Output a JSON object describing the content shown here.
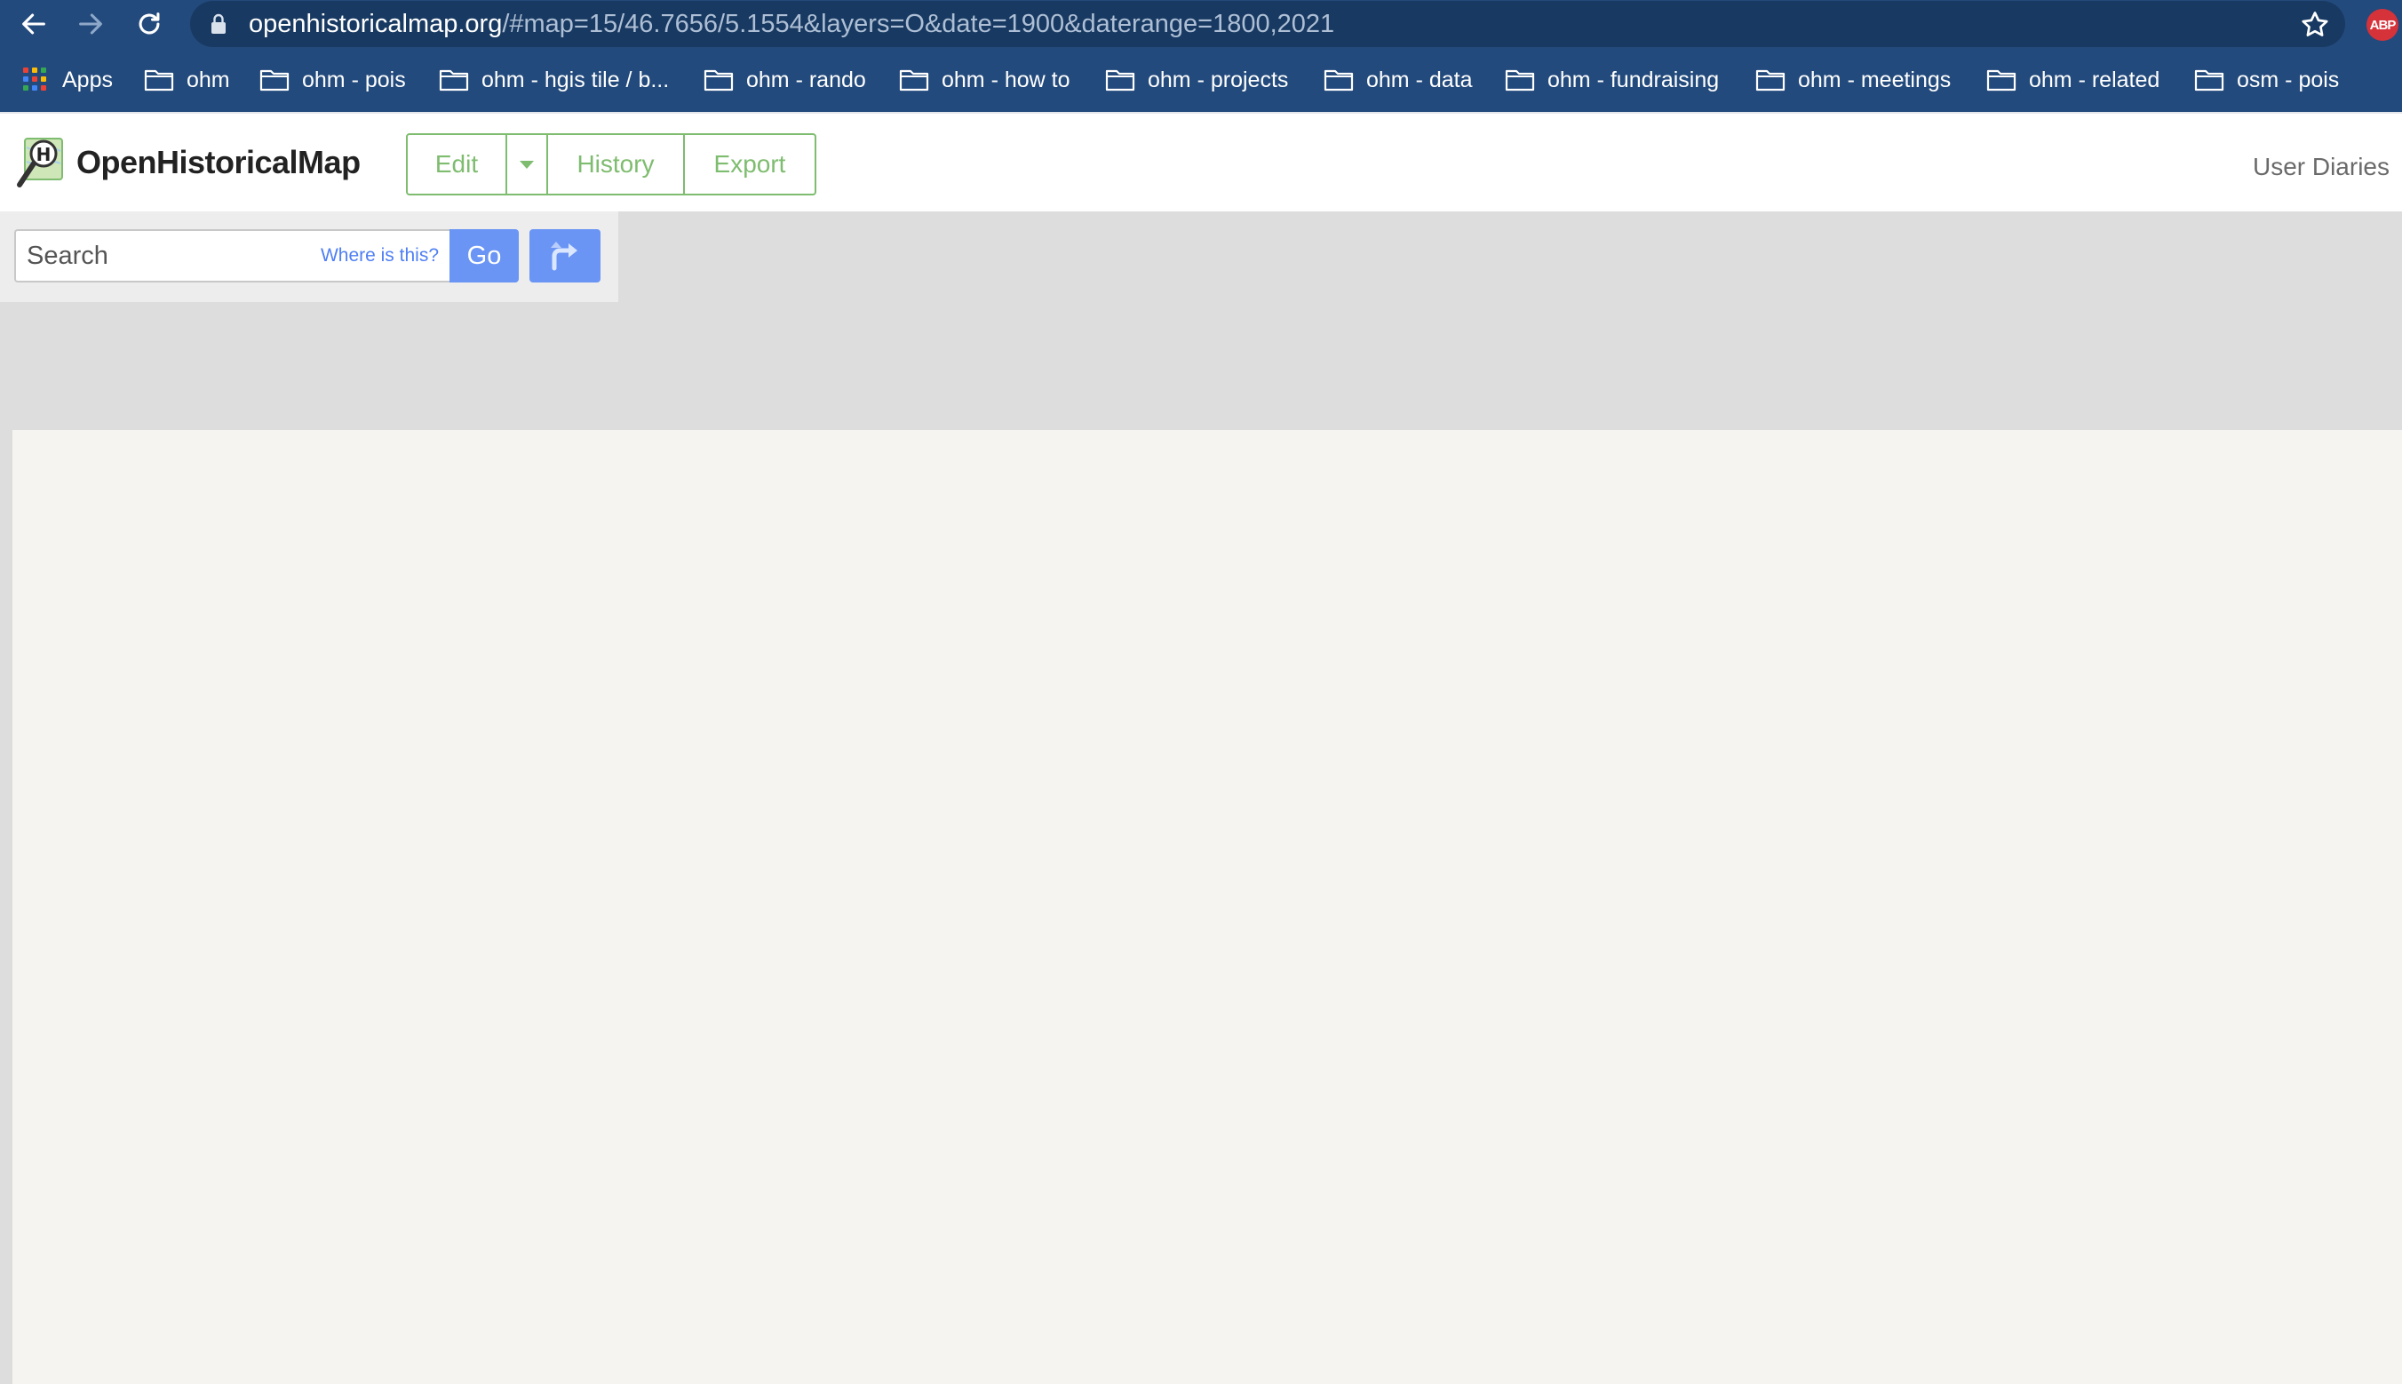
{
  "browser": {
    "url_host": "openhistoricalmap.org",
    "url_rest": "/#map=15/46.7656/5.1554&layers=O&date=1900&daterange=1800,2021",
    "extension_badge": "ABP",
    "bookmarks": [
      {
        "label": "Apps",
        "icon": "apps-grid-icon"
      },
      {
        "label": "ohm",
        "icon": "folder-icon"
      },
      {
        "label": "ohm - pois",
        "icon": "folder-icon"
      },
      {
        "label": "ohm - hgis tile / b...",
        "icon": "folder-icon"
      },
      {
        "label": "ohm - rando",
        "icon": "folder-icon"
      },
      {
        "label": "ohm - how to",
        "icon": "folder-icon"
      },
      {
        "label": "ohm - projects",
        "icon": "folder-icon"
      },
      {
        "label": "ohm - data",
        "icon": "folder-icon"
      },
      {
        "label": "ohm - fundraising",
        "icon": "folder-icon"
      },
      {
        "label": "ohm - meetings",
        "icon": "folder-icon"
      },
      {
        "label": "ohm - related",
        "icon": "folder-icon"
      },
      {
        "label": "osm - pois",
        "icon": "folder-icon"
      }
    ]
  },
  "header": {
    "site_name": "OpenHistoricalMap",
    "buttons": {
      "edit": "Edit",
      "history": "History",
      "export": "Export"
    },
    "user_diaries": "User Diaries"
  },
  "search": {
    "placeholder": "Search",
    "where_is_this": "Where is this?",
    "go": "Go"
  },
  "colors": {
    "browser_chrome": "#234a7c",
    "omnibox": "#183961",
    "accent_green": "#7ebc6f",
    "button_blue": "#6a95f5",
    "link_blue": "#4f7ff3",
    "map_background": "#f5f4f0"
  }
}
